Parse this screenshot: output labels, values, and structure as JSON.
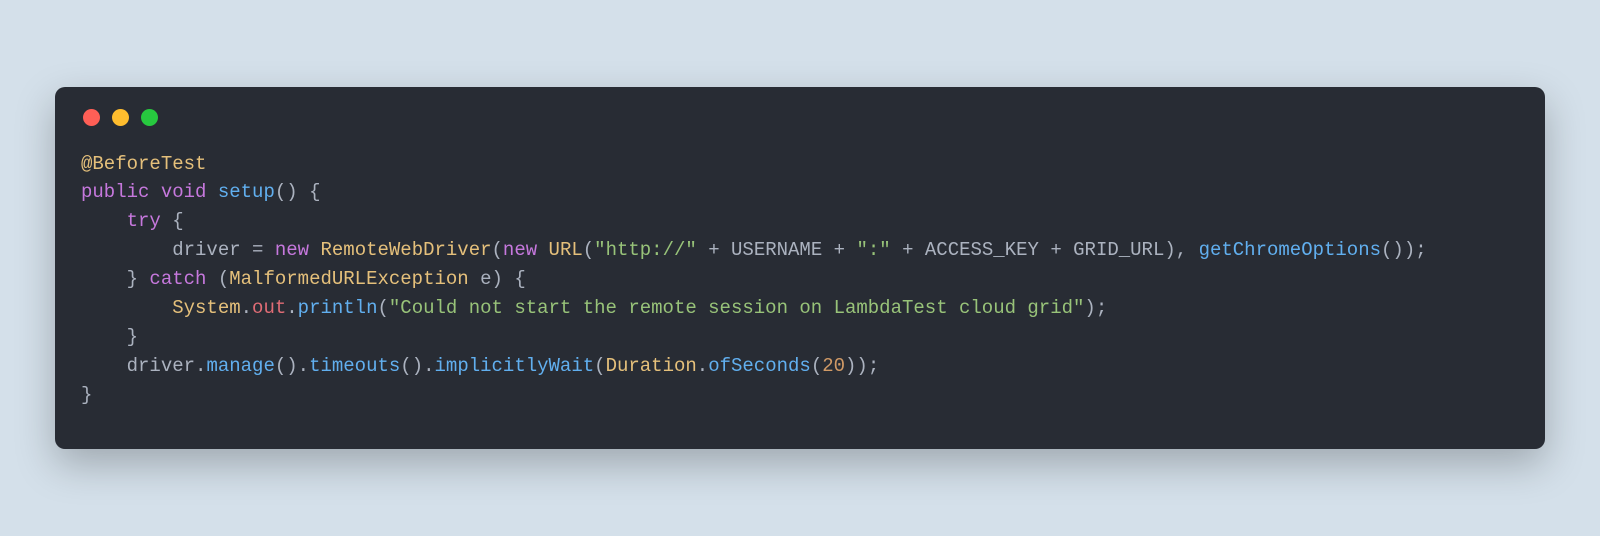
{
  "window": {
    "controls": [
      "close",
      "minimize",
      "maximize"
    ]
  },
  "colors": {
    "bg_page": "#d4e0ea",
    "bg_editor": "#282c34",
    "red": "#ff5f56",
    "yellow": "#ffbd2e",
    "green": "#27c93f"
  },
  "code": {
    "line1": {
      "annotation": "@BeforeTest"
    },
    "line2": {
      "kw_public": "public",
      "kw_void": "void",
      "method": "setup",
      "parens": "()",
      "brace": " {"
    },
    "line3": {
      "indent": "    ",
      "kw_try": "try",
      "brace": " {"
    },
    "line4": {
      "indent": "        ",
      "var_driver": "driver",
      "assign": " = ",
      "kw_new1": "new",
      "sp1": " ",
      "cls_rwd": "RemoteWebDriver",
      "open1": "(",
      "kw_new2": "new",
      "sp2": " ",
      "cls_url": "URL",
      "open2": "(",
      "str_http": "\"http://\"",
      "plus1": " + ",
      "const_user": "USERNAME",
      "plus2": " + ",
      "str_colon": "\":\"",
      "plus3": " + ",
      "const_key": "ACCESS_KEY",
      "plus4": " + ",
      "const_grid": "GRID_URL",
      "close1": "), ",
      "method_gco": "getChromeOptions",
      "call1": "());"
    },
    "line5": {
      "indent": "    ",
      "brace_close": "}",
      "sp": " ",
      "kw_catch": "catch",
      "sp2": " (",
      "cls_exc": "MalformedURLException",
      "sp3": " ",
      "var_e": "e",
      "close": ") {"
    },
    "line6": {
      "indent": "        ",
      "cls_system": "System",
      "dot1": ".",
      "prop_out": "out",
      "dot2": ".",
      "method_println": "println",
      "open": "(",
      "str_msg": "\"Could not start the remote session on LambdaTest cloud grid\"",
      "close": ");"
    },
    "line7": {
      "indent": "    ",
      "brace": "}"
    },
    "line8": {
      "indent": "    ",
      "var_driver": "driver",
      "dot1": ".",
      "m_manage": "manage",
      "call1": "()",
      "dot2": ".",
      "m_timeouts": "timeouts",
      "call2": "()",
      "dot3": ".",
      "m_wait": "implicitlyWait",
      "open": "(",
      "cls_dur": "Duration",
      "dot4": ".",
      "m_ofsec": "ofSeconds",
      "open2": "(",
      "num": "20",
      "close": "));"
    },
    "line9": {
      "brace": "}"
    }
  }
}
